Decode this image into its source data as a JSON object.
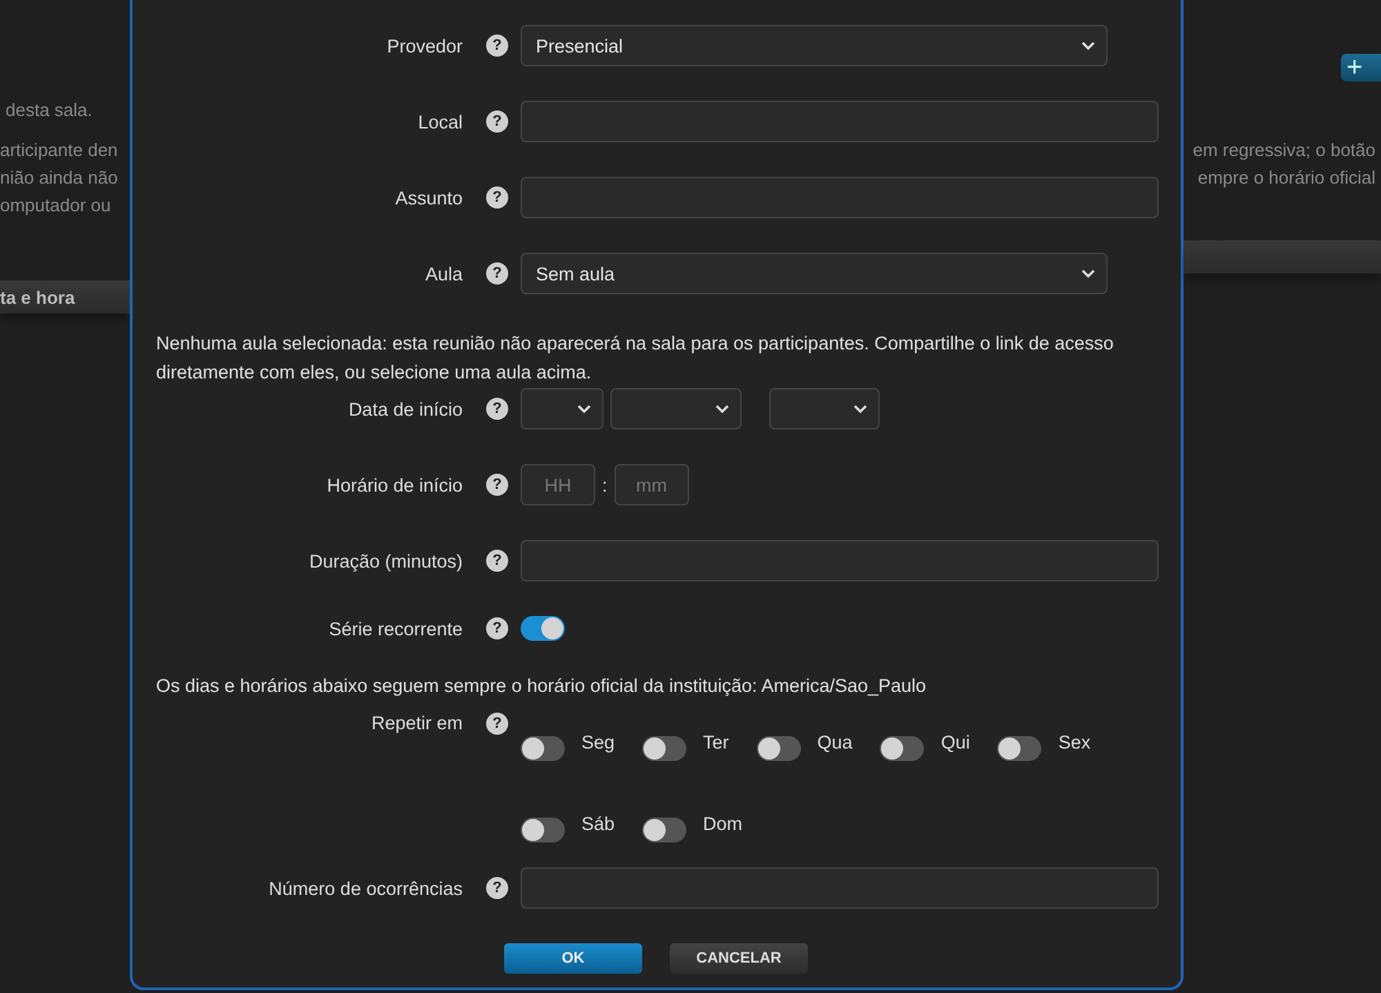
{
  "background": {
    "left_lines": [
      {
        "text": "desta sala."
      },
      {
        "text": "articipante den"
      },
      {
        "text": "nião ainda não"
      },
      {
        "text": "omputador ou"
      }
    ],
    "left_header": "ta e hora",
    "right_lines": [
      {
        "text": "em regressiva; o botão"
      },
      {
        "text": "empre o horário oficial"
      }
    ],
    "add_button": "+"
  },
  "form": {
    "rows": [
      {
        "kind": "select",
        "label": "Provedor",
        "help": "?",
        "value": "Presencial"
      },
      {
        "kind": "input",
        "label": "Local",
        "help": "?"
      },
      {
        "kind": "input",
        "label": "Assunto",
        "help": "?"
      },
      {
        "kind": "select",
        "label": "Aula",
        "help": "?",
        "value": "Sem aula"
      },
      {
        "kind": "note",
        "text": "Nenhuma aula selecionada: esta reunião não aparecerá na sala para os participantes. Compartilhe o link de acesso diretamente com eles, ou selecione uma aula acima."
      },
      {
        "kind": "date",
        "label": "Data de início",
        "help": "?"
      },
      {
        "kind": "time",
        "label": "Horário de início",
        "help": "?",
        "hour_placeholder": "HH",
        "separator": ":",
        "minute_placeholder": "mm"
      },
      {
        "kind": "input",
        "label": "Duração (minutos)",
        "help": "?"
      },
      {
        "kind": "switch",
        "label": "Série recorrente",
        "help": "?",
        "on": true
      },
      {
        "kind": "note",
        "text": "Os dias e horários abaixo seguem sempre o horário oficial da instituição: America/Sao_Paulo"
      },
      {
        "kind": "days",
        "label": "Repetir em",
        "help": "?",
        "days": [
          {
            "label": "Seg",
            "on": false
          },
          {
            "label": "Ter",
            "on": false
          },
          {
            "label": "Qua",
            "on": false
          },
          {
            "label": "Qui",
            "on": false
          },
          {
            "label": "Sex",
            "on": false
          },
          {
            "label": "Sáb",
            "on": false
          },
          {
            "label": "Dom",
            "on": false
          }
        ]
      },
      {
        "kind": "input",
        "label": "Número de ocorrências",
        "help": "?"
      }
    ],
    "buttons": [
      {
        "label": "OK",
        "kind": "primary"
      },
      {
        "label": "CANCELAR",
        "kind": "secondary"
      }
    ]
  }
}
